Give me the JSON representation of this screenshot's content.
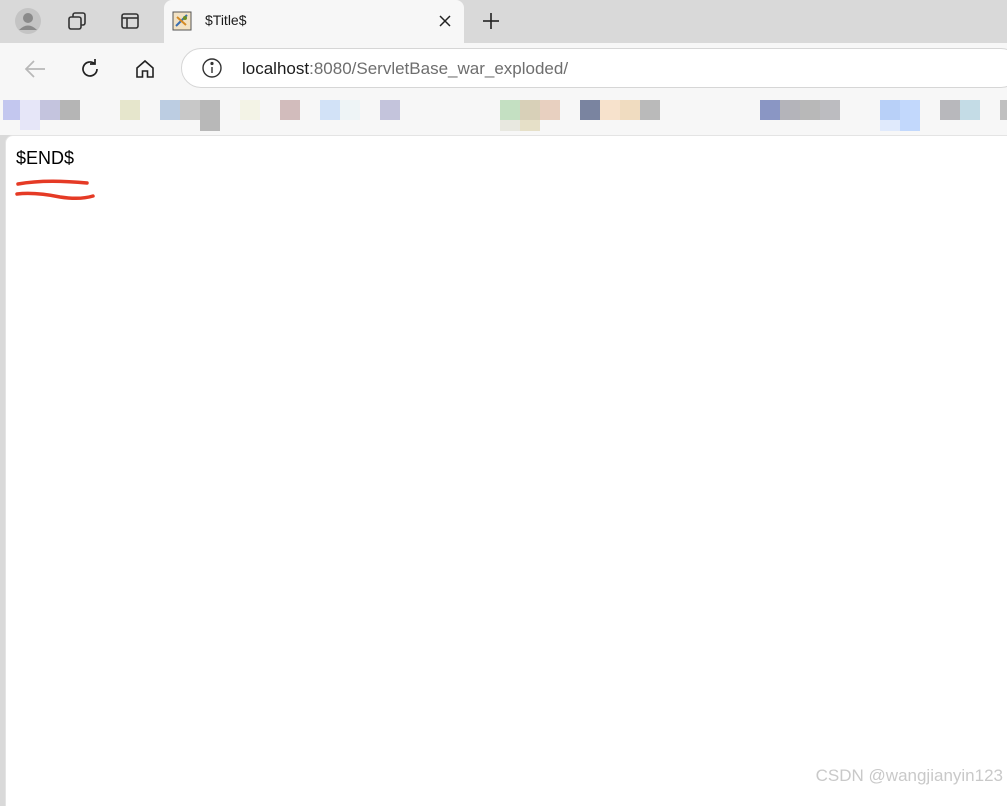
{
  "window": {
    "tab": {
      "title": "$Title$"
    }
  },
  "toolbar": {
    "url": {
      "host": "localhost",
      "rest": ":8080/ServletBase_war_exploded/"
    }
  },
  "page": {
    "body_text": "$END$"
  },
  "watermark": "CSDN @wangjianyin123",
  "icons": {
    "profile": "profile-icon",
    "collections": "collections-icon",
    "tab_actions": "tab-actions-icon",
    "favicon": "java-favicon-icon",
    "close": "close-icon",
    "new_tab": "plus-icon",
    "back": "back-arrow-icon",
    "refresh": "refresh-icon",
    "home": "home-icon",
    "info": "info-icon"
  },
  "colors": {
    "tab_strip": "#d9d9d9",
    "toolbar": "#f7f7f7",
    "page_bg": "#ffffff",
    "annotation": "#e53a25",
    "watermark": "#c9c9c9"
  }
}
